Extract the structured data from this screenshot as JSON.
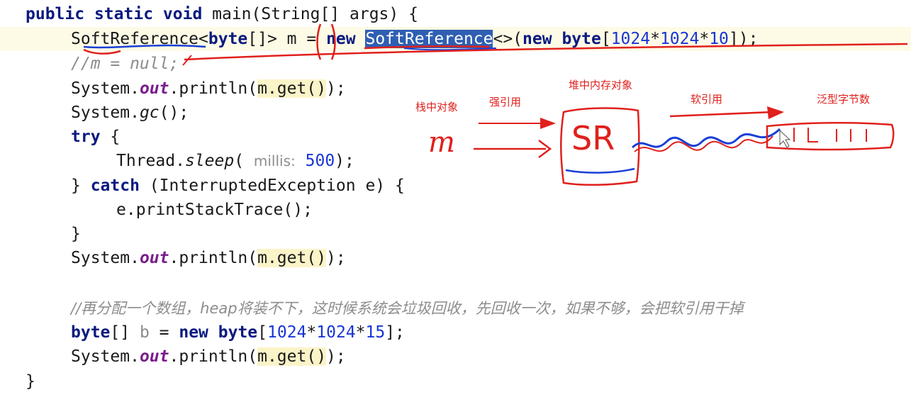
{
  "code": {
    "l1": {
      "kw1": "public",
      "kw2": "static",
      "kw3": "void",
      "rest": " main(String[] args) {"
    },
    "l2": {
      "type": "SoftReference",
      "generic_open": "<",
      "byte_kw": "byte",
      "generic_close": "[]> ",
      "var": "m",
      "eq": " = ",
      "new_kw": "new",
      "space": " ",
      "sel_type": "SoftReference",
      "diamond": "<>(",
      "new_kw2": "new",
      "byte_kw2": "byte",
      "br_open": "[",
      "n1": "1024",
      "star1": "*",
      "n2": "1024",
      "star2": "*",
      "n3": "10",
      "br_close": "]);"
    },
    "l3": {
      "comment": "//m = null;"
    },
    "l4": {
      "a": "System.",
      "field": "out",
      "b": ".println(",
      "call": "m.get()",
      "c": ");"
    },
    "l5": {
      "a": "System.",
      "method": "gc",
      "b": "();"
    },
    "l6": {
      "kw": "try",
      "b": " {"
    },
    "l7": {
      "a": "Thread.",
      "method": "sleep",
      "b": "( ",
      "hint": "millis:",
      "space": " ",
      "num": "500",
      "c": ");"
    },
    "l8": {
      "a": "} ",
      "kw": "catch",
      "b": " (InterruptedException e) {"
    },
    "l9": {
      "a": "e.printStackTrace();"
    },
    "l10": {
      "a": "}"
    },
    "l11": {
      "a": "System.",
      "field": "out",
      "b": ".println(",
      "call": "m.get()",
      "c": ");"
    },
    "l12": {
      "comment": "//再分配一个数组，heap将装不下，这时候系统会垃圾回收，先回收一次，如果不够，会把软引用干掉"
    },
    "l13": {
      "byte_kw": "byte",
      "a": "[] ",
      "var": "b",
      "b": " = ",
      "new_kw": "new",
      "space": " ",
      "byte_kw2": "byte",
      "br_open": "[",
      "n1": "1024",
      "star1": "*",
      "n2": "1024",
      "star2": "*",
      "n3": "15",
      "br_close": "];"
    },
    "l14": {
      "a": "System.",
      "field": "out",
      "b": ".println(",
      "call": "m.get()",
      "c": ");"
    },
    "l15": {
      "a": "}"
    }
  },
  "annotations": {
    "stack_object": "栈中对象",
    "strong_ref": "强引用",
    "heap_object": "堆中内存对象",
    "soft_ref": "软引用",
    "generic_bytes": "泛型字节数",
    "var_m": "m",
    "sr": "SR"
  },
  "colors": {
    "annotation_red": "#e0201c",
    "annotation_blue": "#1a3fd6",
    "selection": "#2f5fb3"
  }
}
